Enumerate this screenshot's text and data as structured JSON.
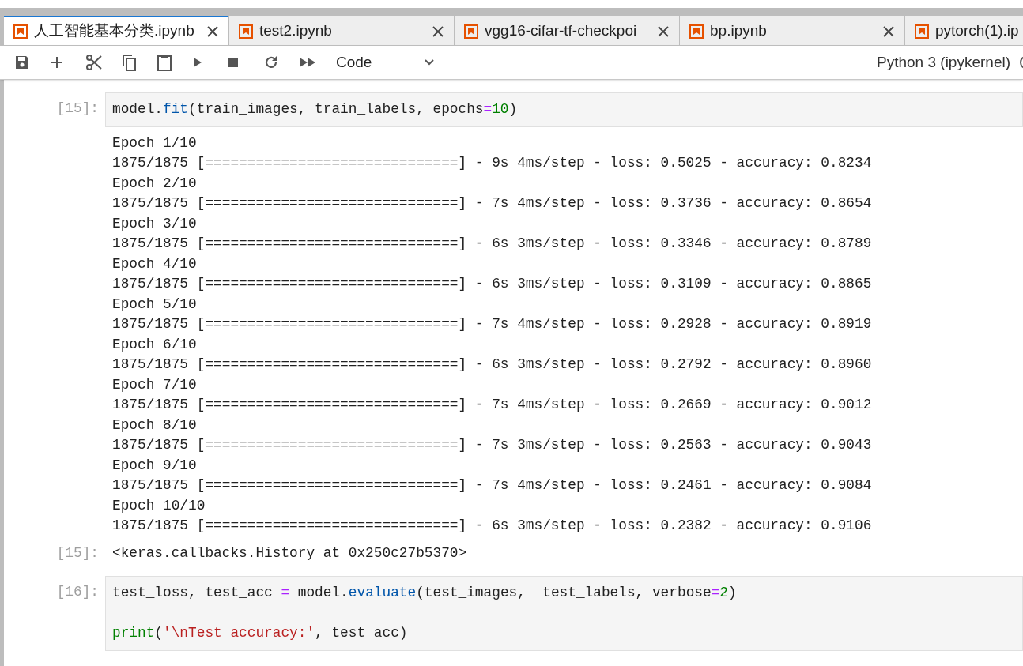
{
  "tabs": [
    {
      "label": "人工智能基本分类.ipynb",
      "selected": true
    },
    {
      "label": "test2.ipynb",
      "selected": false
    },
    {
      "label": "vgg16-cifar-tf-checkpoi",
      "selected": false
    },
    {
      "label": "bp.ipynb",
      "selected": false
    },
    {
      "label": "pytorch(1).ip",
      "selected": false
    }
  ],
  "toolbar": {
    "cell_type": "Code",
    "kernel": "Python 3 (ipykernel)"
  },
  "cells": [
    {
      "kind": "code",
      "prompt": "[15]:",
      "lines": [
        {
          "kind": "code",
          "tokens": [
            {
              "kind": "plain",
              "s": "model."
            },
            {
              "kind": "attr",
              "s": "fit"
            },
            {
              "kind": "plain",
              "s": "(train_images, train_labels, epochs"
            },
            {
              "kind": "op",
              "s": "="
            },
            {
              "kind": "num",
              "s": "10"
            },
            {
              "kind": "plain",
              "s": ")"
            }
          ]
        }
      ],
      "outputs": [
        {
          "kind": "stream",
          "lines": [
            "Epoch 1/10",
            "1875/1875 [==============================] - 9s 4ms/step - loss: 0.5025 - accuracy: 0.8234",
            "Epoch 2/10",
            "1875/1875 [==============================] - 7s 4ms/step - loss: 0.3736 - accuracy: 0.8654",
            "Epoch 3/10",
            "1875/1875 [==============================] - 6s 3ms/step - loss: 0.3346 - accuracy: 0.8789",
            "Epoch 4/10",
            "1875/1875 [==============================] - 6s 3ms/step - loss: 0.3109 - accuracy: 0.8865",
            "Epoch 5/10",
            "1875/1875 [==============================] - 7s 4ms/step - loss: 0.2928 - accuracy: 0.8919",
            "Epoch 6/10",
            "1875/1875 [==============================] - 6s 3ms/step - loss: 0.2792 - accuracy: 0.8960",
            "Epoch 7/10",
            "1875/1875 [==============================] - 7s 4ms/step - loss: 0.2669 - accuracy: 0.9012",
            "Epoch 8/10",
            "1875/1875 [==============================] - 7s 3ms/step - loss: 0.2563 - accuracy: 0.9043",
            "Epoch 9/10",
            "1875/1875 [==============================] - 7s 4ms/step - loss: 0.2461 - accuracy: 0.9084",
            "Epoch 10/10",
            "1875/1875 [==============================] - 6s 3ms/step - loss: 0.2382 - accuracy: 0.9106"
          ]
        },
        {
          "kind": "result",
          "prompt": "[15]:",
          "text": "<keras.callbacks.History at 0x250c27b5370>"
        }
      ]
    },
    {
      "kind": "code",
      "prompt": "[16]:",
      "lines": [
        {
          "kind": "code",
          "tokens": [
            {
              "kind": "plain",
              "s": "test_loss, test_acc "
            },
            {
              "kind": "op",
              "s": "="
            },
            {
              "kind": "plain",
              "s": " model."
            },
            {
              "kind": "attr",
              "s": "evaluate"
            },
            {
              "kind": "plain",
              "s": "(test_images,  test_labels, verbose"
            },
            {
              "kind": "op",
              "s": "="
            },
            {
              "kind": "num",
              "s": "2"
            },
            {
              "kind": "plain",
              "s": ")"
            }
          ]
        },
        {
          "kind": "blank"
        },
        {
          "kind": "code",
          "tokens": [
            {
              "kind": "builtin",
              "s": "print"
            },
            {
              "kind": "plain",
              "s": "("
            },
            {
              "kind": "str",
              "s": "'\\nTest accuracy:'"
            },
            {
              "kind": "plain",
              "s": ", test_acc)"
            }
          ]
        }
      ]
    }
  ]
}
